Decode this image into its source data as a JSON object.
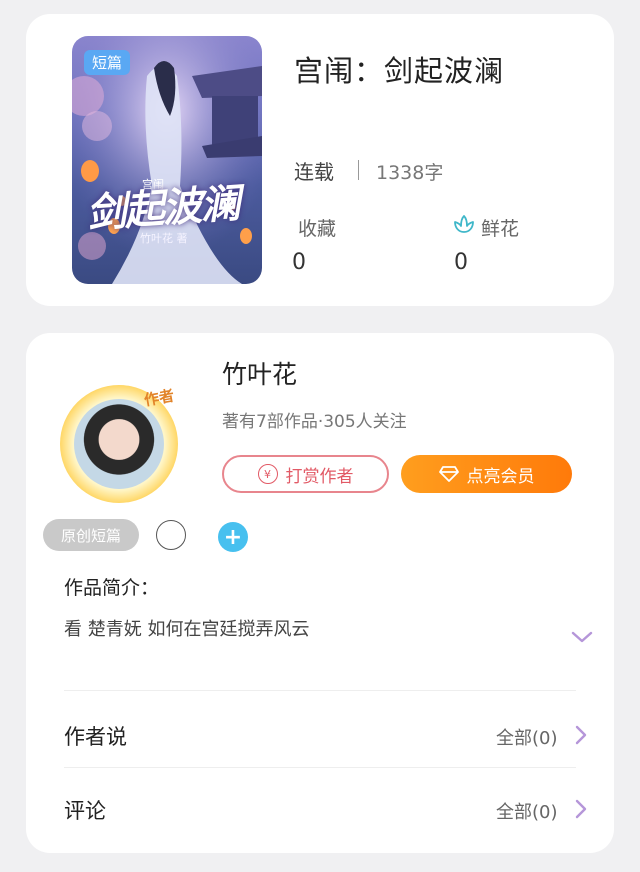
{
  "book": {
    "cover_badge": "短篇",
    "cover_title": "剑起波澜",
    "cover_small": "宫闱",
    "cover_author": "竹叶花 著",
    "title": "宫闱：剑起波澜",
    "status": "连载",
    "word_count": "1338字",
    "favorites_label": "收藏",
    "favorites_value": "0",
    "flowers_label": "鲜花",
    "flowers_value": "0"
  },
  "author": {
    "tag": "作者",
    "name": "竹叶花",
    "stats": "著有7部作品·305人关注",
    "tip_button": "打赏作者",
    "tip_icon": "¥",
    "vip_button": "点亮会员"
  },
  "tags": {
    "pill": "原创短篇",
    "plus": "+"
  },
  "intro": {
    "label": "作品简介：",
    "text": "看 楚青妩 如何在宫廷搅弄风云"
  },
  "rows": [
    {
      "label": "作者说",
      "right": "全部(0)"
    },
    {
      "label": "评论",
      "right": "全部(0)"
    }
  ],
  "colors": {
    "accent_orange": "#ff8a12",
    "tip_red": "#e25a66",
    "plus_blue": "#47c0ef",
    "chevron_purple": "#b596d9"
  }
}
